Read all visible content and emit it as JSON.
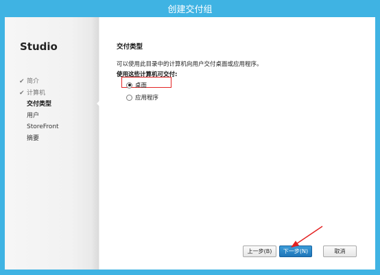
{
  "window": {
    "title": "创建交付组"
  },
  "sidebar": {
    "app_title": "Studio",
    "steps": [
      {
        "label": "简介",
        "state": "done"
      },
      {
        "label": "计算机",
        "state": "done"
      },
      {
        "label": "交付类型",
        "state": "active"
      },
      {
        "label": "用户",
        "state": "pending"
      },
      {
        "label": "StoreFront",
        "state": "pending"
      },
      {
        "label": "摘要",
        "state": "pending"
      }
    ]
  },
  "main": {
    "heading": "交付类型",
    "description": "可以使用此目录中的计算机向用户交付桌面或应用程序。",
    "question": "使用这些计算机可交付:",
    "options": [
      {
        "label": "桌面",
        "selected": true
      },
      {
        "label": "应用程序",
        "selected": false
      }
    ]
  },
  "buttons": {
    "back": "上一步(B)",
    "next": "下一步(N)",
    "cancel": "取消"
  },
  "colors": {
    "titlebar": "#3fb3e3",
    "primary_button": "#1f75b8",
    "annotation": "#e32020"
  }
}
